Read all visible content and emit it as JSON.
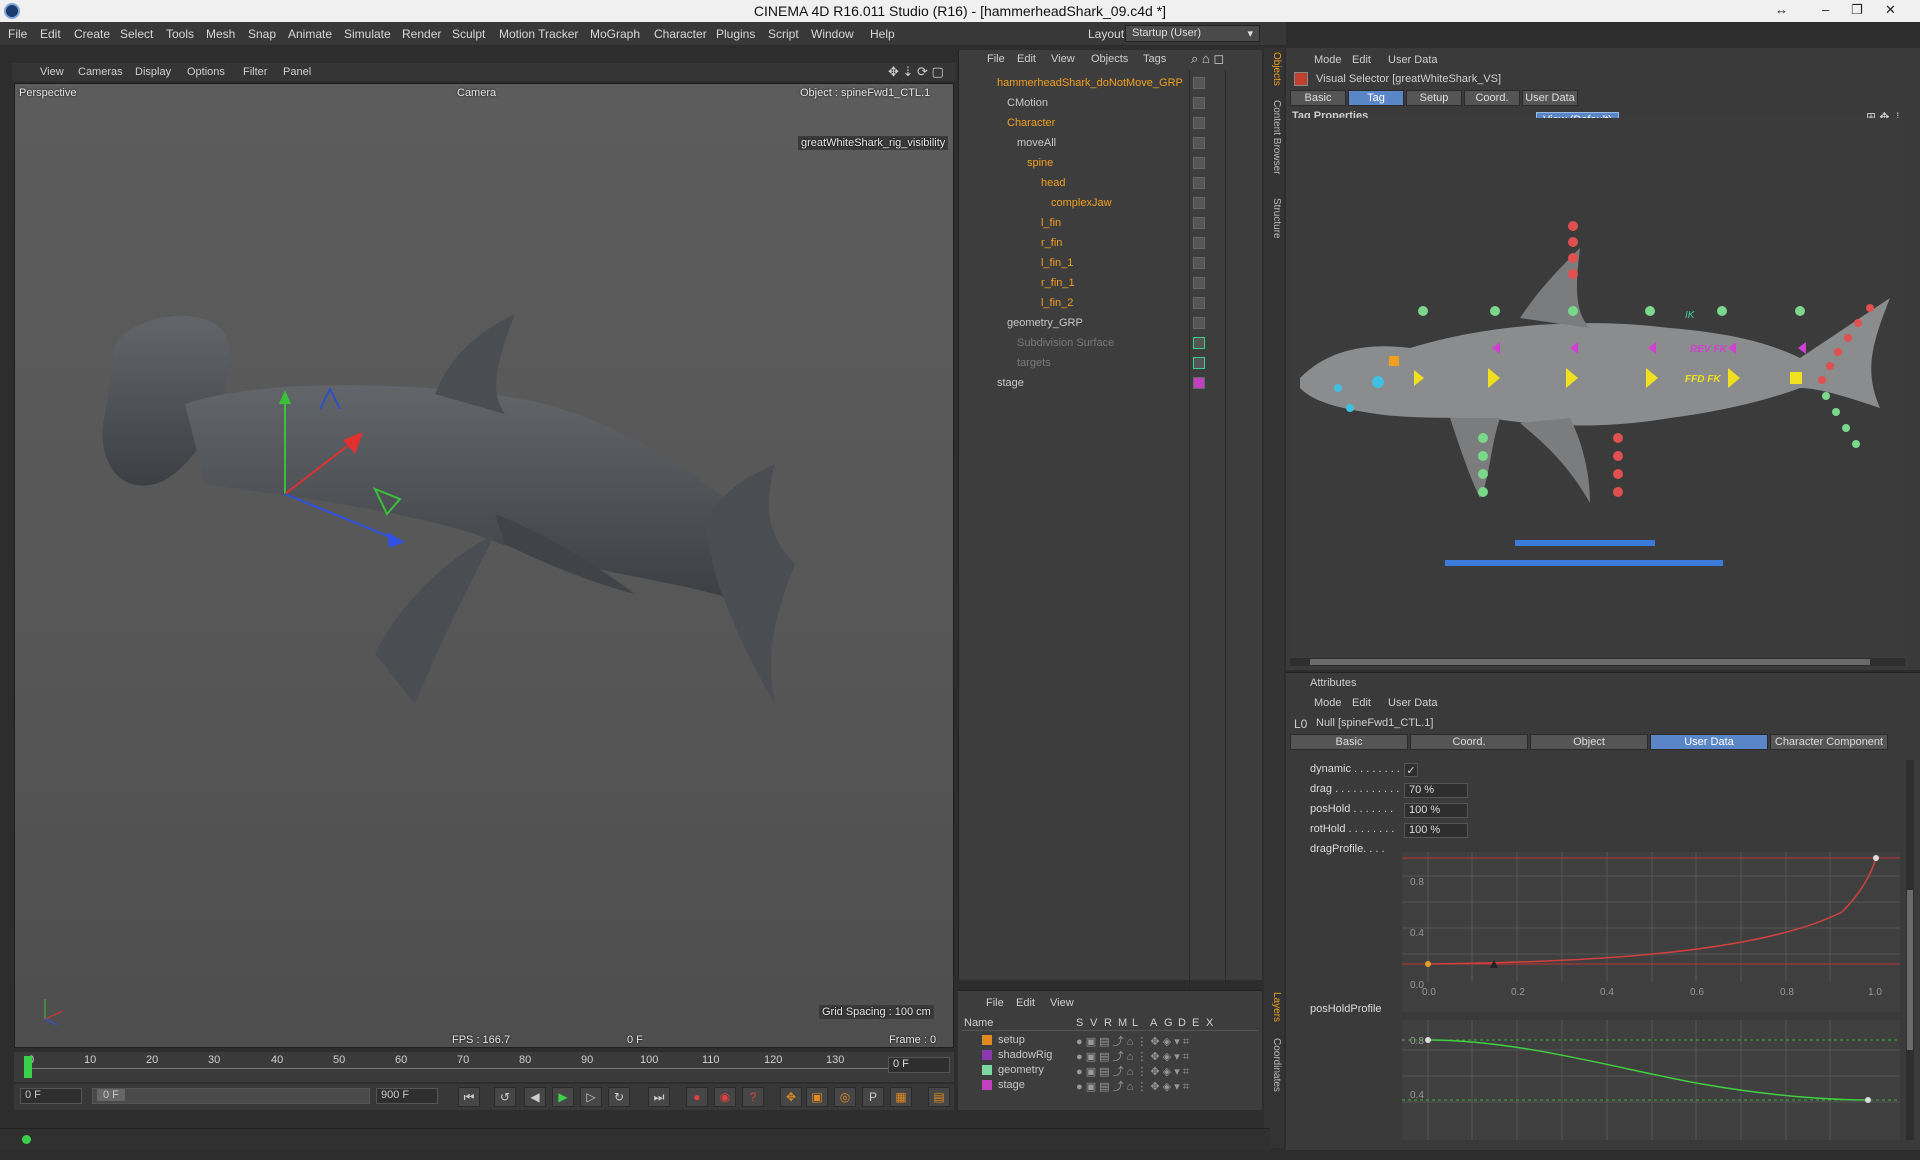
{
  "window": {
    "title": "CINEMA 4D R16.011 Studio (R16) - [hammerheadShark_09.c4d *]"
  },
  "menu": [
    "File",
    "Edit",
    "Create",
    "Select",
    "Tools",
    "Mesh",
    "Snap",
    "Animate",
    "Simulate",
    "Render",
    "Sculpt",
    "Motion Tracker",
    "MoGraph",
    "Character",
    "Plugins",
    "Script",
    "Window",
    "Help"
  ],
  "layout": {
    "label": "Layout:",
    "value": "Startup (User)"
  },
  "viewport": {
    "menu": [
      "View",
      "Cameras",
      "Display",
      "Options",
      "Filter",
      "Panel"
    ],
    "view_name": "Perspective",
    "camera": "Camera",
    "object_label": "Object : spineFwd1_CTL.1",
    "hud_label": "greatWhiteShark_rig_visibility",
    "grid_spacing": "Grid Spacing : 100 cm",
    "fps": "FPS : 166.7",
    "frame_marker": "0 F",
    "frame": "Frame : 0"
  },
  "timeline": {
    "ticks": [
      "0",
      "10",
      "20",
      "30",
      "40",
      "50",
      "60",
      "70",
      "80",
      "90",
      "100",
      "110",
      "120",
      "130"
    ],
    "current": "0 F",
    "start": "0 F",
    "range_start": "0 F",
    "end": "900 F"
  },
  "object_manager": {
    "menu": [
      "File",
      "Edit",
      "View",
      "Objects",
      "Tags"
    ],
    "rows": [
      {
        "name": "hammerheadShark_doNotMove_GRP",
        "style": "orange"
      },
      {
        "name": "CMotion",
        "style": "normal"
      },
      {
        "name": "Character",
        "style": "orange"
      },
      {
        "name": "moveAll",
        "style": "normal"
      },
      {
        "name": "spine",
        "style": "orange"
      },
      {
        "name": "head",
        "style": "orange"
      },
      {
        "name": "complexJaw",
        "style": "orange"
      },
      {
        "name": "l_fin",
        "style": "orange"
      },
      {
        "name": "r_fin",
        "style": "orange"
      },
      {
        "name": "l_fin_1",
        "style": "orange"
      },
      {
        "name": "r_fin_1",
        "style": "orange"
      },
      {
        "name": "l_fin_2",
        "style": "orange"
      },
      {
        "name": "geometry_GRP",
        "style": "normal"
      },
      {
        "name": "Subdivision Surface",
        "style": "dim"
      },
      {
        "name": "targets",
        "style": "dim"
      },
      {
        "name": "stage",
        "style": "normal"
      }
    ]
  },
  "layer_manager": {
    "menu": [
      "File",
      "Edit",
      "View"
    ],
    "headers": [
      "Name",
      "S",
      "V",
      "R",
      "M",
      "L",
      "A",
      "G",
      "D",
      "E",
      "X"
    ],
    "rows": [
      {
        "name": "setup",
        "color": "#e08a20"
      },
      {
        "name": "shadowRig",
        "color": "#8a3ab0"
      },
      {
        "name": "geometry",
        "color": "#7ad8a0"
      },
      {
        "name": "stage",
        "color": "#c040c0"
      }
    ]
  },
  "side_tabs": [
    "Objects",
    "Content Browser",
    "Structure",
    "Layers",
    "Coordinates"
  ],
  "visual_selector": {
    "menu": [
      "Mode",
      "Edit",
      "User Data"
    ],
    "title": "Visual Selector [greatWhiteShark_VS]",
    "tabs": [
      "Basic",
      "Tag",
      "Setup",
      "Coord.",
      "User Data"
    ],
    "active_tab": "Tag",
    "section": "Tag Properties",
    "view_button": "View (Default)",
    "labels": {
      "ik": "IK",
      "rev_fk": "REV FK",
      "ffd_fk": "FFD FK"
    }
  },
  "attributes": {
    "header": "Attributes",
    "menu": [
      "Mode",
      "Edit",
      "User Data"
    ],
    "object": "Null [spineFwd1_CTL.1]",
    "tabs": [
      "Basic",
      "Coord.",
      "Object",
      "User Data",
      "Character Component"
    ],
    "active_tab": "User Data",
    "fields": {
      "dynamic": {
        "label": "dynamic . . . . . . . .",
        "value": "✓"
      },
      "drag": {
        "label": "drag . . . . . . . . . . .",
        "value": "70 %"
      },
      "posHold": {
        "label": "posHold . . . . . . .",
        "value": "100 %"
      },
      "rotHold": {
        "label": "rotHold . . . . . . . .",
        "value": "100 %"
      },
      "dragProfile": {
        "label": "dragProfile. . . ."
      },
      "posHoldProfile": {
        "label": "posHoldProfile"
      }
    },
    "graph_x_ticks": [
      "0.0",
      "0.2",
      "0.4",
      "0.6",
      "0.8",
      "1.0"
    ],
    "graph_y_ticks": [
      "0.8",
      "0.4",
      "0.0"
    ],
    "graph2_y_ticks": [
      "0.8",
      "0.4"
    ]
  },
  "colors": {
    "accent": "#5a86c8",
    "selection_orange": "#f0a020",
    "vs_yellow": "#f0e020",
    "vs_green": "#7ad88a",
    "vs_red": "#e05050",
    "vs_magenta": "#d040d0",
    "vs_cyan": "#40c0e0",
    "vs_blue_bar": "#3a7ad8"
  }
}
